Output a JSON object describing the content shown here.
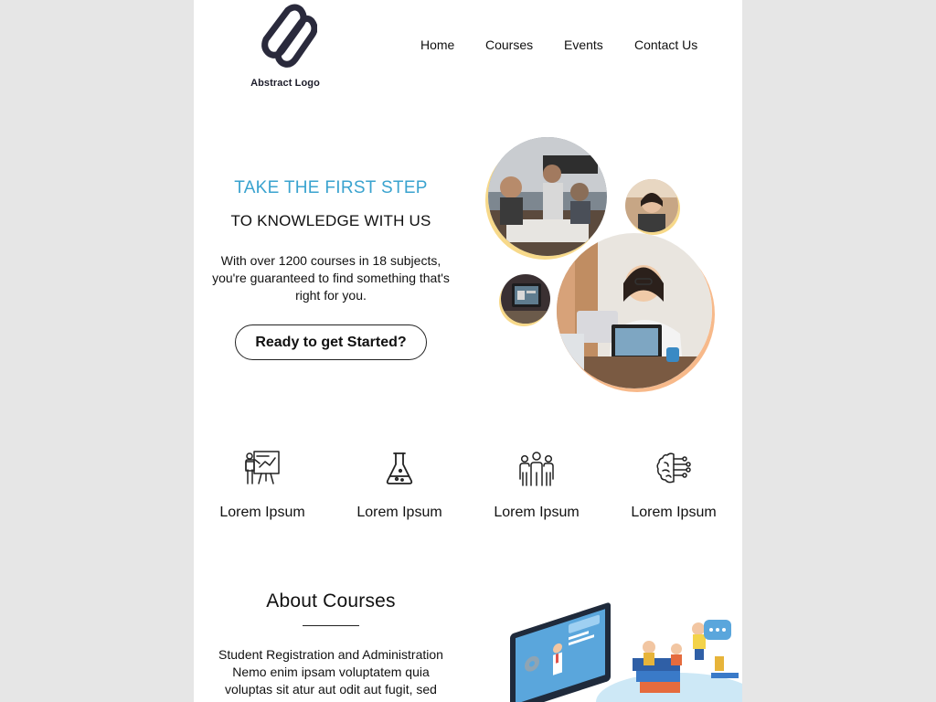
{
  "brand": {
    "logo_text": "Abstract Logo"
  },
  "nav": {
    "items": [
      "Home",
      "Courses",
      "Events",
      "Contact Us"
    ]
  },
  "hero": {
    "kicker": "TAKE THE FIRST STEP",
    "title": "TO KNOWLEDGE WITH US",
    "body": "With over 1200 courses in 18 subjects, you're guaranteed to find something that's right for you.",
    "cta_label": "Ready to get Started?"
  },
  "features": [
    {
      "icon": "presentation-icon",
      "label": "Lorem Ipsum"
    },
    {
      "icon": "flask-icon",
      "label": "Lorem Ipsum"
    },
    {
      "icon": "people-icon",
      "label": "Lorem Ipsum"
    },
    {
      "icon": "brain-circuit-icon",
      "label": "Lorem Ipsum"
    }
  ],
  "about": {
    "title": "About Courses",
    "subtitle": "Student Registration and Administration",
    "body": "Nemo enim ipsam voluptatem quia voluptas sit atur aut odit aut fugit, sed"
  },
  "colors": {
    "page_bg": "#e6e6e6",
    "content_bg": "#ffffff",
    "accent_blue": "#3aa3cf",
    "bubble_ring_gold": "#f7d98a",
    "bubble_ring_peach": "#f7b98a"
  }
}
